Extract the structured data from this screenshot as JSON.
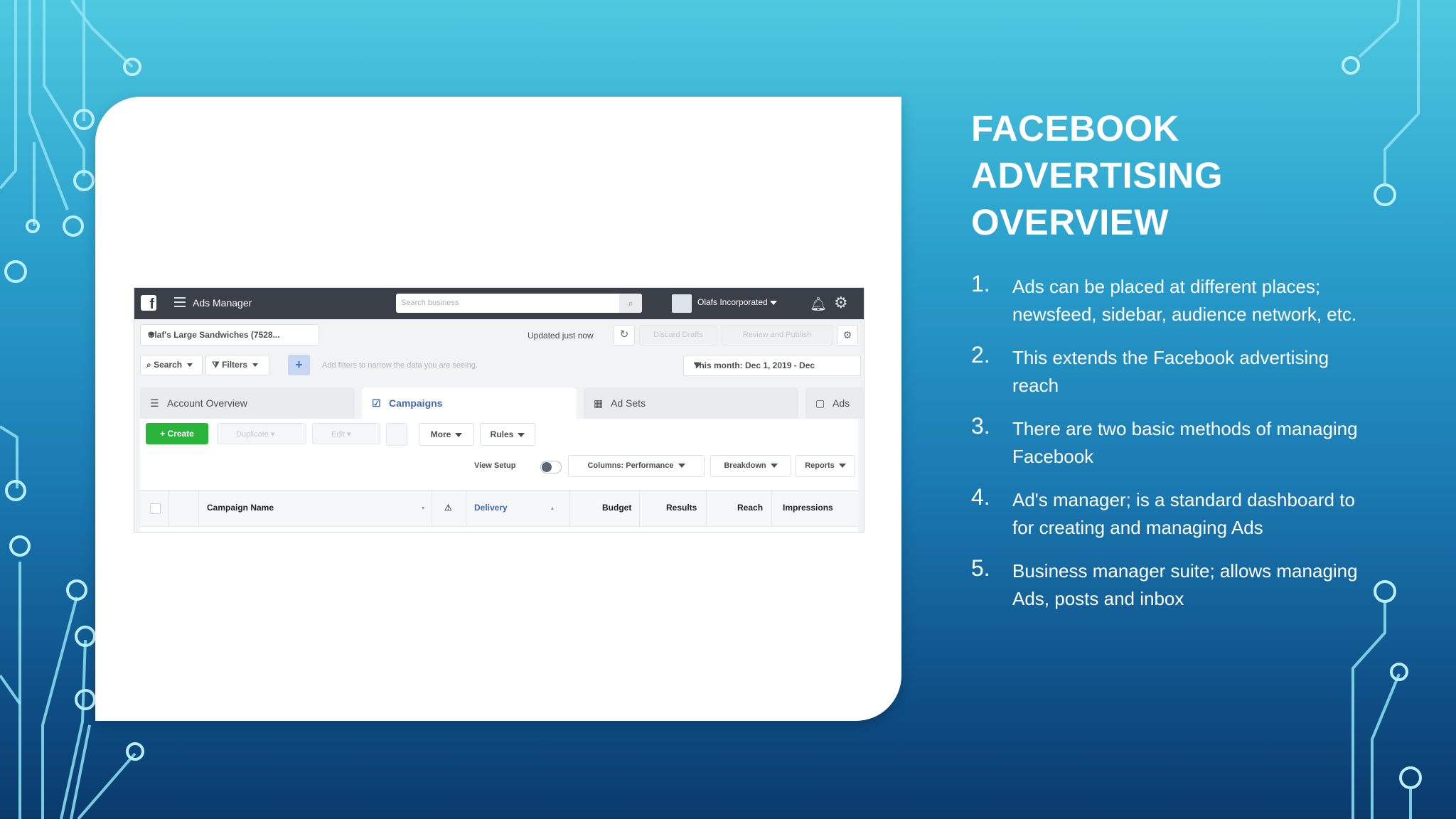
{
  "slide": {
    "heading_lines": [
      "FACEBOOK",
      "ADVERTISING",
      "OVERVIEW"
    ],
    "points": [
      {
        "num": "1.",
        "text": "Ads can be placed at different places; newsfeed, sidebar, audience network, etc."
      },
      {
        "num": "2.",
        "text": "This extends the Facebook advertising reach"
      },
      {
        "num": "3.",
        "text": "There are two basic methods of managing Facebook"
      },
      {
        "num": "4.",
        "text": "Ad's manager; is a standard dashboard to for creating and managing Ads"
      },
      {
        "num": "5.",
        "text": "Business manager suite; allows managing Ads, posts and inbox"
      }
    ]
  },
  "ads_manager": {
    "app_title": "Ads Manager",
    "search_placeholder": "Search business",
    "business_name": "Olafs Incorporated",
    "account_name": "Olaf's Large Sandwiches (7528...",
    "updated_text": "Updated just now",
    "discard_drafts": "Discard Drafts",
    "review_publish": "Review and Publish",
    "search_label": "Search",
    "filters_label": "Filters",
    "filter_placeholder": "Add filters to narrow the data you are seeing.",
    "date_range": "This month: Dec 1, 2019 - Dec",
    "tabs": [
      {
        "label": "Account Overview",
        "icon": "account-overview-icon"
      },
      {
        "label": "Campaigns",
        "icon": "campaigns-icon"
      },
      {
        "label": "Ad Sets",
        "icon": "ad-sets-icon"
      },
      {
        "label": "Ads",
        "icon": "ads-icon"
      }
    ],
    "toolbar": {
      "create": "Create",
      "duplicate": "Duplicate",
      "edit": "Edit",
      "more": "More",
      "rules": "Rules"
    },
    "view_setup": "View Setup",
    "columns": "Columns: Performance",
    "breakdown": "Breakdown",
    "reports": "Reports",
    "table_headers": {
      "campaign_name": "Campaign Name",
      "delivery": "Delivery",
      "budget": "Budget",
      "results": "Results",
      "reach": "Reach",
      "impressions": "Impressions"
    },
    "colors": {
      "accent": "#4267b2",
      "create": "#2bb43a",
      "topbar": "#3a3f48"
    }
  }
}
